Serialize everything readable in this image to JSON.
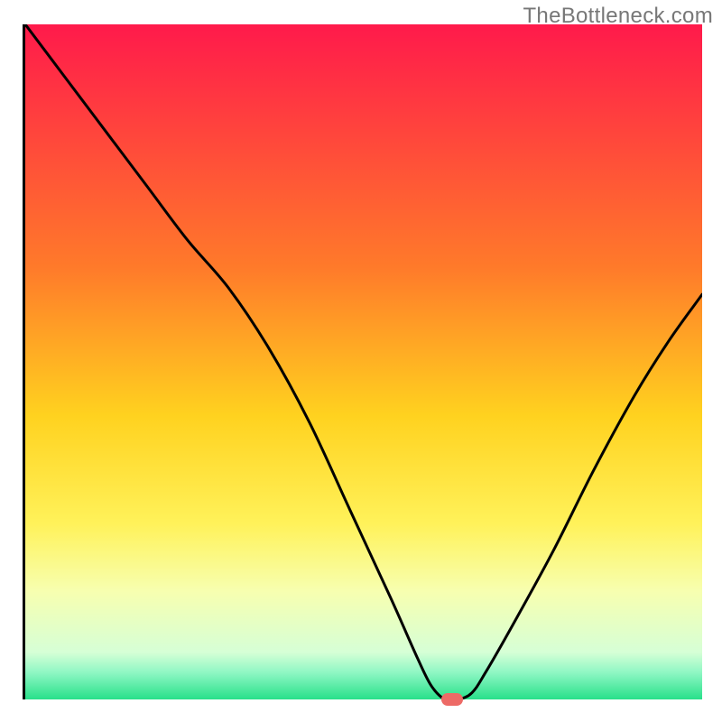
{
  "watermark": "TheBottleneck.com",
  "chart_data": {
    "type": "line",
    "title": "",
    "xlabel": "",
    "ylabel": "",
    "xlim": [
      0,
      100
    ],
    "ylim": [
      0,
      100
    ],
    "grid": false,
    "legend": false,
    "gradient_stops": [
      {
        "offset": 0,
        "color": "#ff1a4b"
      },
      {
        "offset": 0.36,
        "color": "#ff7a2a"
      },
      {
        "offset": 0.58,
        "color": "#ffd21f"
      },
      {
        "offset": 0.74,
        "color": "#fff25a"
      },
      {
        "offset": 0.84,
        "color": "#f7ffb0"
      },
      {
        "offset": 0.93,
        "color": "#d6ffd6"
      },
      {
        "offset": 0.96,
        "color": "#8ff7c4"
      },
      {
        "offset": 1.0,
        "color": "#28e08a"
      }
    ],
    "series": [
      {
        "name": "curve",
        "x": [
          0,
          6,
          12,
          18,
          24,
          30,
          36,
          42,
          48,
          54,
          58,
          60,
          62,
          64,
          66,
          68,
          72,
          78,
          84,
          90,
          95,
          100
        ],
        "values": [
          100,
          92,
          84,
          76,
          68,
          61,
          52,
          41,
          28,
          15,
          6,
          2,
          0,
          0,
          1,
          4,
          11,
          22,
          34,
          45,
          53,
          60
        ]
      }
    ],
    "marker": {
      "x": 63,
      "y": 0,
      "color": "#ed6a66"
    }
  }
}
